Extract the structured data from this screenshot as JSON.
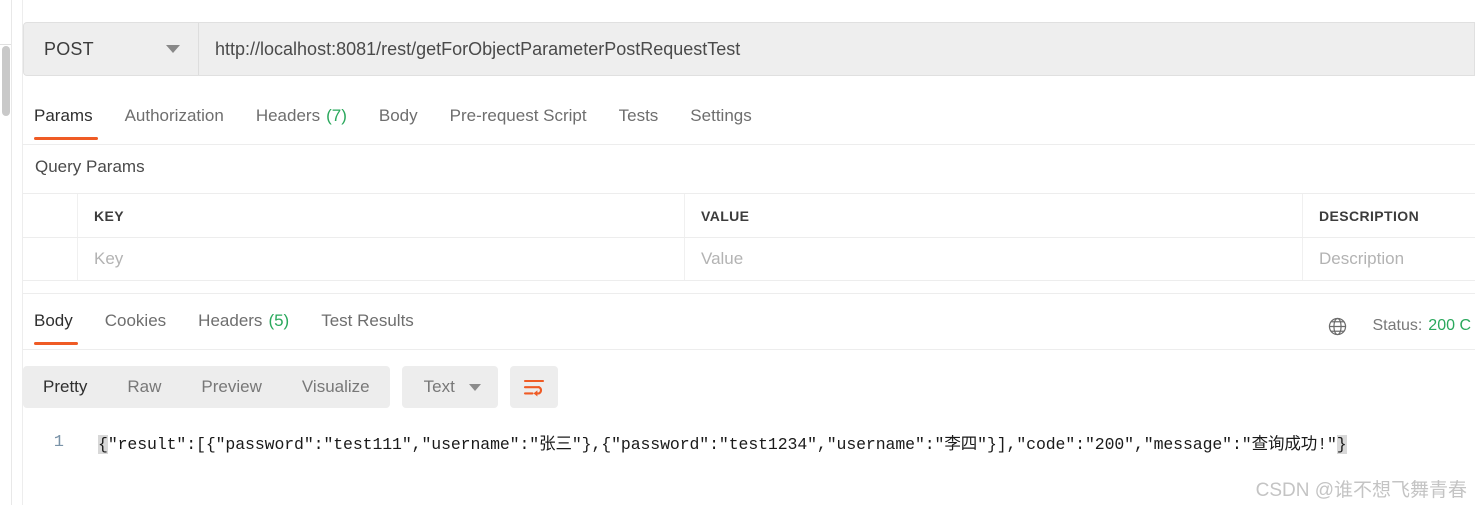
{
  "request": {
    "method": "POST",
    "method_caret_icon": "chevron-down-icon",
    "url": "http://localhost:8081/rest/getForObjectParameterPostRequestTest",
    "url_placeholder": "Enter request URL",
    "tabs": [
      {
        "label": "Params",
        "count": "",
        "active": true
      },
      {
        "label": "Authorization",
        "count": "",
        "active": false
      },
      {
        "label": "Headers",
        "count": "(7)",
        "active": false
      },
      {
        "label": "Body",
        "count": "",
        "active": false
      },
      {
        "label": "Pre-request Script",
        "count": "",
        "active": false
      },
      {
        "label": "Tests",
        "count": "",
        "active": false
      },
      {
        "label": "Settings",
        "count": "",
        "active": false
      }
    ]
  },
  "query_params": {
    "section_title": "Query Params",
    "columns": [
      "KEY",
      "VALUE",
      "DESCRIPTION"
    ],
    "row_placeholders": {
      "key": "Key",
      "value": "Value",
      "description": "Description"
    }
  },
  "response": {
    "tabs": [
      {
        "label": "Body",
        "count": "",
        "active": true
      },
      {
        "label": "Cookies",
        "count": "",
        "active": false
      },
      {
        "label": "Headers",
        "count": "(5)",
        "active": false
      },
      {
        "label": "Test Results",
        "count": "",
        "active": false
      }
    ],
    "globe_icon": "globe-icon",
    "status_label": "Status:",
    "status_code": "200 C",
    "viewer": {
      "modes": [
        {
          "label": "Pretty",
          "active": true
        },
        {
          "label": "Raw",
          "active": false
        },
        {
          "label": "Preview",
          "active": false
        },
        {
          "label": "Visualize",
          "active": false
        }
      ],
      "format": "Text",
      "format_caret_icon": "chevron-down-icon",
      "wrap_icon": "wrap-text-icon"
    },
    "body": {
      "line_number": "1",
      "open_brace": "{",
      "content": "\"result\":[{\"password\":\"test111\",\"username\":\"张三\"},{\"password\":\"test1234\",\"username\":\"李四\"}],\"code\":\"200\",\"message\":\"查询成功!\"",
      "close_brace": "}"
    }
  },
  "watermark": "CSDN @谁不想飞舞青春",
  "colors": {
    "accent": "#ef5b25",
    "success": "#2aa85c",
    "toolbar_bg": "#ededed",
    "text": "#3c3c3c",
    "muted": "#787878"
  }
}
